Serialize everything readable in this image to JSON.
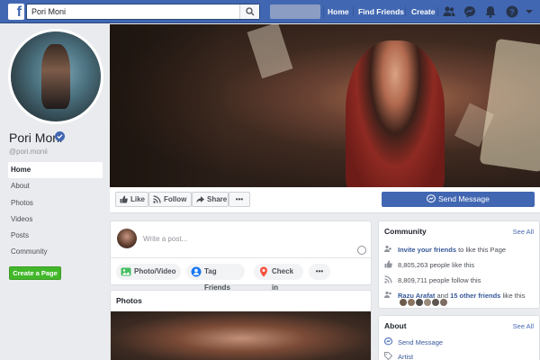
{
  "topbar": {
    "logo": "f",
    "search_value": "Pori Moni",
    "nav": {
      "home": "Home",
      "find_friends": "Find Friends",
      "create": "Create"
    }
  },
  "page": {
    "name": "Pori Moni",
    "handle": "@pori.monii"
  },
  "leftnav": {
    "items": [
      "Home",
      "About",
      "Photos",
      "Videos",
      "Posts",
      "Community"
    ],
    "active": "Home",
    "create_page": "Create a Page"
  },
  "actions": {
    "like": "Like",
    "follow": "Follow",
    "share": "Share",
    "more": "•••",
    "send_message": "Send Message"
  },
  "composer": {
    "placeholder": "Write a post...",
    "photo_video": "Photo/Video",
    "tag_friends": "Tag Friends",
    "check_in": "Check in",
    "more": "•••"
  },
  "photos": {
    "title": "Photos"
  },
  "community": {
    "title": "Community",
    "see_all": "See All",
    "invite_link": "Invite your friends",
    "invite_rest": " to like this Page",
    "likes": "8,805,263 people like this",
    "follows": "8,809,711 people follow this",
    "friend_name": "Razu Arafat",
    "friend_and": " and ",
    "friend_others": "15 other friends",
    "friend_rest": " like this"
  },
  "about": {
    "title": "About",
    "see_all": "See All",
    "send_message": "Send Message",
    "category": "Artist"
  },
  "colors": {
    "brand": "#4267b2",
    "background": "#e9ebee",
    "green": "#42b72a",
    "link": "#365899"
  }
}
